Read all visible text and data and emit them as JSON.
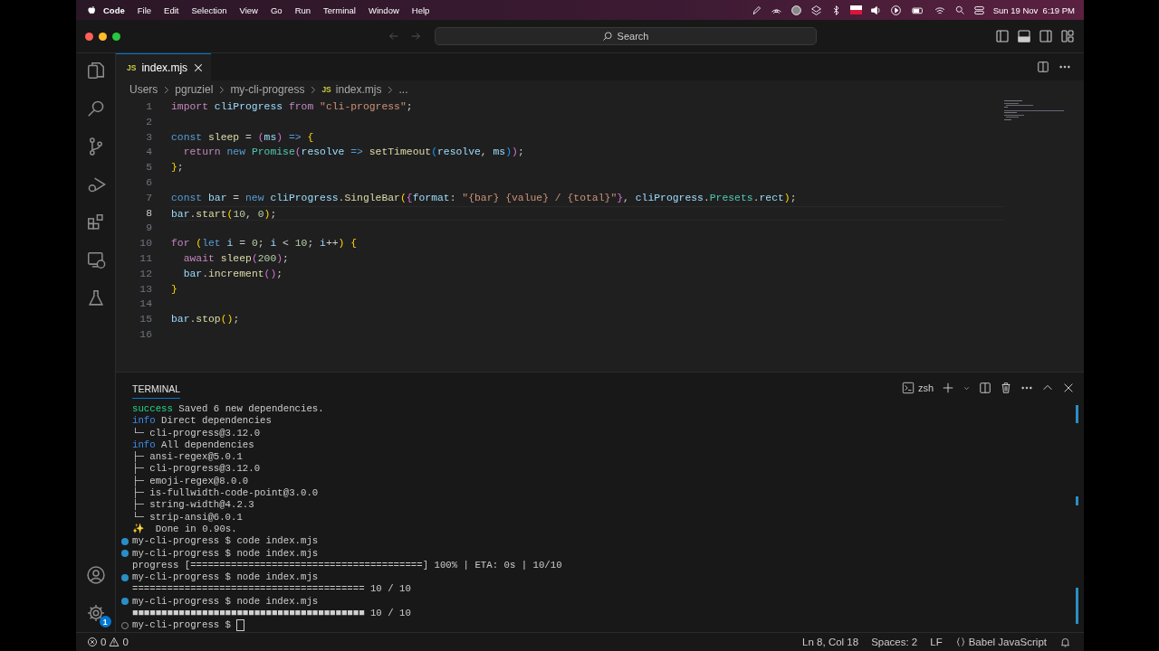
{
  "menu_bar": {
    "app": "Code",
    "menus": [
      "File",
      "Edit",
      "Selection",
      "View",
      "Go",
      "Run",
      "Terminal",
      "Window",
      "Help"
    ],
    "clock": "Sun 19 Nov  6:19 PM"
  },
  "window": {
    "search": {
      "placeholder": "Search"
    }
  },
  "tabs": [
    {
      "label": "index.mjs",
      "badge": "JS",
      "selected": true
    }
  ],
  "breadcrumb": [
    {
      "label": "Users"
    },
    {
      "label": "pgruziel"
    },
    {
      "label": "my-cli-progress"
    },
    {
      "label": "index.mjs",
      "badge": "JS"
    },
    {
      "label": "..."
    }
  ],
  "editor": {
    "lines": [
      {
        "number": "1",
        "current": false,
        "tokens": [
          {
            "kind": "kw",
            "text": "import "
          },
          {
            "kind": "v",
            "text": "cliProgress "
          },
          {
            "kind": "kw",
            "text": "from "
          },
          {
            "kind": "s",
            "text": "\"cli-progress\""
          },
          {
            "kind": "p",
            "text": ";"
          }
        ]
      },
      {
        "number": "2",
        "current": false
      },
      {
        "number": "3",
        "current": false,
        "tokens": [
          {
            "kind": "st",
            "text": "const "
          },
          {
            "kind": "f",
            "text": "sleep "
          },
          {
            "kind": "p",
            "text": "= "
          },
          {
            "kind": "b2",
            "text": "("
          },
          {
            "kind": "v",
            "text": "ms"
          },
          {
            "kind": "b2",
            "text": ") "
          },
          {
            "kind": "st",
            "text": "=> "
          },
          {
            "kind": "b1",
            "text": "{"
          }
        ]
      },
      {
        "number": "4",
        "current": false,
        "tokens": [
          {
            "kind": "kw",
            "text": "  return "
          },
          {
            "kind": "st",
            "text": "new "
          },
          {
            "kind": "c",
            "text": "Promise"
          },
          {
            "kind": "b2",
            "text": "("
          },
          {
            "kind": "v",
            "text": "resolve "
          },
          {
            "kind": "st",
            "text": "=> "
          },
          {
            "kind": "f",
            "text": "setTimeout"
          },
          {
            "kind": "b3",
            "text": "("
          },
          {
            "kind": "v",
            "text": "resolve"
          },
          {
            "kind": "p",
            "text": ", "
          },
          {
            "kind": "v",
            "text": "ms"
          },
          {
            "kind": "b3",
            "text": ")"
          },
          {
            "kind": "b2",
            "text": ")"
          },
          {
            "kind": "p",
            "text": ";"
          }
        ]
      },
      {
        "number": "5",
        "current": false,
        "tokens": [
          {
            "kind": "b1",
            "text": "}"
          },
          {
            "kind": "p",
            "text": ";"
          }
        ]
      },
      {
        "number": "6",
        "current": false
      },
      {
        "number": "7",
        "current": false,
        "tokens": [
          {
            "kind": "st",
            "text": "const "
          },
          {
            "kind": "v",
            "text": "bar "
          },
          {
            "kind": "p",
            "text": "= "
          },
          {
            "kind": "st",
            "text": "new "
          },
          {
            "kind": "v",
            "text": "cliProgress"
          },
          {
            "kind": "p",
            "text": "."
          },
          {
            "kind": "f",
            "text": "SingleBar"
          },
          {
            "kind": "b1",
            "text": "("
          },
          {
            "kind": "b2",
            "text": "{"
          },
          {
            "kind": "v",
            "text": "format"
          },
          {
            "kind": "p",
            "text": ": "
          },
          {
            "kind": "s",
            "text": "\"{bar} {value} / {total}\""
          },
          {
            "kind": "b2",
            "text": "}"
          },
          {
            "kind": "p",
            "text": ", "
          },
          {
            "kind": "v",
            "text": "cliProgress"
          },
          {
            "kind": "p",
            "text": "."
          },
          {
            "kind": "c",
            "text": "Presets"
          },
          {
            "kind": "p",
            "text": "."
          },
          {
            "kind": "v",
            "text": "rect"
          },
          {
            "kind": "b1",
            "text": ")"
          },
          {
            "kind": "p",
            "text": ";"
          }
        ]
      },
      {
        "number": "8",
        "current": true,
        "tokens": [
          {
            "kind": "v",
            "text": "bar"
          },
          {
            "kind": "p",
            "text": "."
          },
          {
            "kind": "f",
            "text": "start"
          },
          {
            "kind": "b1",
            "text": "("
          },
          {
            "kind": "n",
            "text": "10"
          },
          {
            "kind": "p",
            "text": ", "
          },
          {
            "kind": "n",
            "text": "0"
          },
          {
            "kind": "b1",
            "text": ")"
          },
          {
            "kind": "p",
            "text": ";"
          }
        ]
      },
      {
        "number": "9",
        "current": false
      },
      {
        "number": "10",
        "current": false,
        "tokens": [
          {
            "kind": "kw",
            "text": "for "
          },
          {
            "kind": "b1",
            "text": "("
          },
          {
            "kind": "st",
            "text": "let "
          },
          {
            "kind": "v",
            "text": "i "
          },
          {
            "kind": "p",
            "text": "= "
          },
          {
            "kind": "n",
            "text": "0"
          },
          {
            "kind": "p",
            "text": "; "
          },
          {
            "kind": "v",
            "text": "i "
          },
          {
            "kind": "p",
            "text": "< "
          },
          {
            "kind": "n",
            "text": "10"
          },
          {
            "kind": "p",
            "text": "; "
          },
          {
            "kind": "v",
            "text": "i"
          },
          {
            "kind": "p",
            "text": "++"
          },
          {
            "kind": "b1",
            "text": ") "
          },
          {
            "kind": "b1",
            "text": "{"
          }
        ]
      },
      {
        "number": "11",
        "current": false,
        "tokens": [
          {
            "kind": "kw",
            "text": "  await "
          },
          {
            "kind": "f",
            "text": "sleep"
          },
          {
            "kind": "b2",
            "text": "("
          },
          {
            "kind": "n",
            "text": "200"
          },
          {
            "kind": "b2",
            "text": ")"
          },
          {
            "kind": "p",
            "text": ";"
          }
        ]
      },
      {
        "number": "12",
        "current": false,
        "tokens": [
          {
            "kind": "v",
            "text": "  bar"
          },
          {
            "kind": "p",
            "text": "."
          },
          {
            "kind": "f",
            "text": "increment"
          },
          {
            "kind": "b2",
            "text": "()"
          },
          {
            "kind": "p",
            "text": ";"
          }
        ]
      },
      {
        "number": "13",
        "current": false,
        "tokens": [
          {
            "kind": "b1",
            "text": "}"
          }
        ]
      },
      {
        "number": "14",
        "current": false
      },
      {
        "number": "15",
        "current": false,
        "tokens": [
          {
            "kind": "v",
            "text": "bar"
          },
          {
            "kind": "p",
            "text": "."
          },
          {
            "kind": "f",
            "text": "stop"
          },
          {
            "kind": "b1",
            "text": "()"
          },
          {
            "kind": "p",
            "text": ";"
          }
        ]
      },
      {
        "number": "16",
        "current": false
      }
    ]
  },
  "panel": {
    "tabs": [
      {
        "label": "TERMINAL",
        "selected": true
      }
    ],
    "shell": "zsh",
    "cursor_visible": true,
    "lines": [
      {
        "kind": "output",
        "segments": [
          {
            "kind": "success",
            "text": "success"
          },
          {
            "kind": "plain",
            "text": " Saved 6 new dependencies."
          }
        ]
      },
      {
        "kind": "output",
        "segments": [
          {
            "kind": "info",
            "text": "info"
          },
          {
            "kind": "plain",
            "text": " Direct dependencies"
          }
        ]
      },
      {
        "kind": "output",
        "segments": [
          {
            "kind": "plain",
            "text": "└─ cli-progress@3.12.0"
          }
        ]
      },
      {
        "kind": "output",
        "segments": [
          {
            "kind": "info",
            "text": "info"
          },
          {
            "kind": "plain",
            "text": " All dependencies"
          }
        ]
      },
      {
        "kind": "output",
        "segments": [
          {
            "kind": "plain",
            "text": "├─ ansi-regex@5.0.1"
          }
        ]
      },
      {
        "kind": "output",
        "segments": [
          {
            "kind": "plain",
            "text": "├─ cli-progress@3.12.0"
          }
        ]
      },
      {
        "kind": "output",
        "segments": [
          {
            "kind": "plain",
            "text": "├─ emoji-regex@8.0.0"
          }
        ]
      },
      {
        "kind": "output",
        "segments": [
          {
            "kind": "plain",
            "text": "├─ is-fullwidth-code-point@3.0.0"
          }
        ]
      },
      {
        "kind": "output",
        "segments": [
          {
            "kind": "plain",
            "text": "├─ string-width@4.2.3"
          }
        ]
      },
      {
        "kind": "output",
        "segments": [
          {
            "kind": "plain",
            "text": "└─ strip-ansi@6.0.1"
          }
        ]
      },
      {
        "kind": "output",
        "segments": [
          {
            "kind": "spark",
            "text": "✨"
          },
          {
            "kind": "plain",
            "text": "  Done in 0.90s."
          }
        ]
      },
      {
        "kind": "done",
        "segments": [
          {
            "kind": "plain",
            "text": "my-cli-progress $ code index.mjs"
          }
        ]
      },
      {
        "kind": "done",
        "segments": [
          {
            "kind": "plain",
            "text": "my-cli-progress $ node index.mjs"
          }
        ]
      },
      {
        "kind": "output",
        "segments": [
          {
            "kind": "plain",
            "text": "progress [========================================] 100% | ETA: 0s | 10/10"
          }
        ]
      },
      {
        "kind": "done",
        "segments": [
          {
            "kind": "plain",
            "text": "my-cli-progress $ node index.mjs"
          }
        ]
      },
      {
        "kind": "output",
        "segments": [
          {
            "kind": "plain",
            "text": "======================================== 10 / 10"
          }
        ]
      },
      {
        "kind": "done",
        "segments": [
          {
            "kind": "plain",
            "text": "my-cli-progress $ node index.mjs"
          }
        ]
      },
      {
        "kind": "output",
        "segments": [
          {
            "kind": "blocks",
            "text": "■■■■■■■■■■■■■■■■■■■■■■■■■■■■■■■■■■■■■■■■"
          },
          {
            "kind": "plain",
            "text": " 10 / 10"
          }
        ]
      },
      {
        "kind": "pending",
        "segments": [
          {
            "kind": "plain",
            "text": "my-cli-progress $ "
          }
        ]
      }
    ]
  },
  "status_bar": {
    "errors": "0",
    "warnings": "0",
    "items": [
      "Ln 8, Col 18",
      "Spaces: 2",
      "LF"
    ],
    "language": "Babel JavaScript"
  },
  "activity_bar": {
    "settings_badge": "1"
  }
}
